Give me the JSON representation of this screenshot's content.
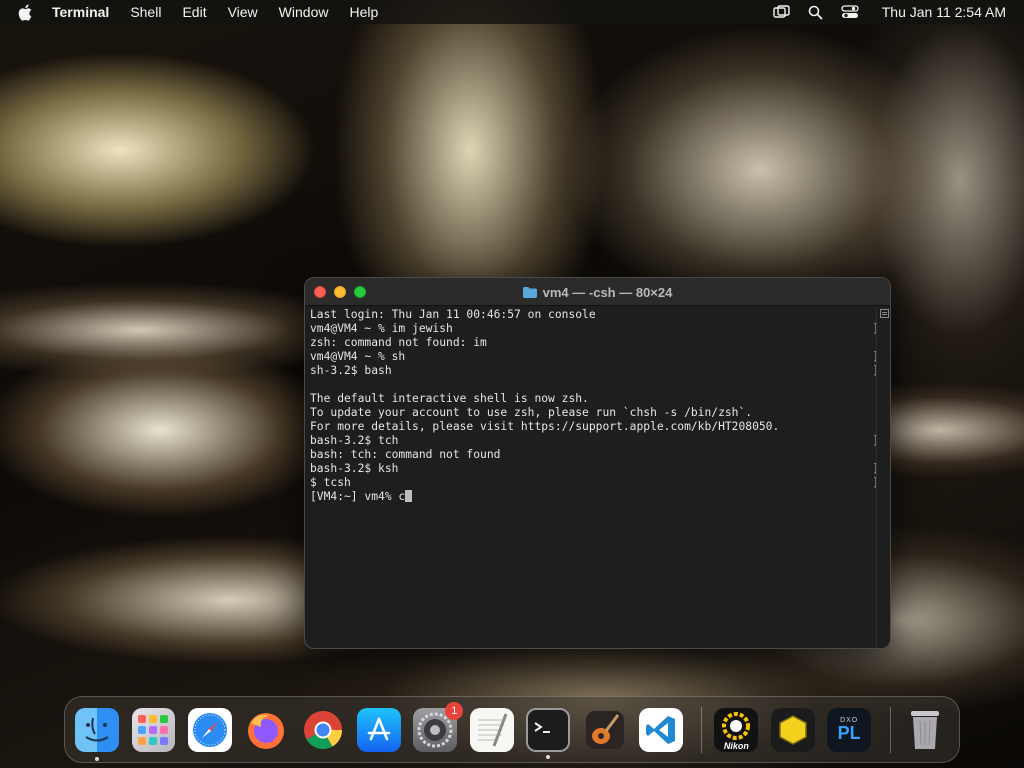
{
  "menubar": {
    "app_name": "Terminal",
    "items": [
      "Shell",
      "Edit",
      "View",
      "Window",
      "Help"
    ],
    "clock": "Thu Jan 11  2:54 AM",
    "status_icons": [
      "screen-mirroring-icon",
      "search-icon",
      "control-center-icon"
    ]
  },
  "terminal": {
    "title": "vm4 — -csh — 80×24",
    "lines": [
      {
        "text": "Last login: Thu Jan 11 00:46:57 on console",
        "mark": false
      },
      {
        "text": "vm4@VM4 ~ % im jewish",
        "mark": true
      },
      {
        "text": "zsh: command not found: im",
        "mark": false
      },
      {
        "text": "vm4@VM4 ~ % sh",
        "mark": true
      },
      {
        "text": "sh-3.2$ bash",
        "mark": true
      },
      {
        "text": "",
        "mark": false
      },
      {
        "text": "The default interactive shell is now zsh.",
        "mark": false
      },
      {
        "text": "To update your account to use zsh, please run `chsh -s /bin/zsh`.",
        "mark": false
      },
      {
        "text": "For more details, please visit https://support.apple.com/kb/HT208050.",
        "mark": false
      },
      {
        "text": "bash-3.2$ tch",
        "mark": true
      },
      {
        "text": "bash: tch: command not found",
        "mark": false
      },
      {
        "text": "bash-3.2$ ksh",
        "mark": true
      },
      {
        "text": "$ tcsh",
        "mark": true
      }
    ],
    "prompt_line": "[VM4:~] vm4% c"
  },
  "dock": {
    "apps": [
      {
        "name": "finder",
        "icon": "finder-icon",
        "running": true
      },
      {
        "name": "launchpad",
        "icon": "launchpad-icon",
        "running": false
      },
      {
        "name": "safari",
        "icon": "safari-icon",
        "running": false
      },
      {
        "name": "firefox",
        "icon": "firefox-icon",
        "running": false
      },
      {
        "name": "chrome",
        "icon": "chrome-icon",
        "running": false
      },
      {
        "name": "app-store",
        "icon": "app-store-icon",
        "running": false
      },
      {
        "name": "system-settings",
        "icon": "gear-icon",
        "running": false,
        "badge": "1"
      },
      {
        "name": "textedit",
        "icon": "textedit-icon",
        "running": false
      },
      {
        "name": "terminal",
        "icon": "terminal-icon",
        "running": true
      },
      {
        "name": "garageband",
        "icon": "guitar-icon",
        "running": false
      },
      {
        "name": "vscode",
        "icon": "vscode-icon",
        "running": false
      }
    ],
    "extra_apps": [
      {
        "name": "nikon",
        "icon": "nikon-icon",
        "label": "Nikon"
      },
      {
        "name": "yellow-app",
        "icon": "yellow-hexagon-icon"
      },
      {
        "name": "dxo-photolab",
        "icon": "pl-icon",
        "label": "PL",
        "sublabel": "DXO"
      }
    ],
    "trash": {
      "icon": "trash-icon"
    }
  }
}
